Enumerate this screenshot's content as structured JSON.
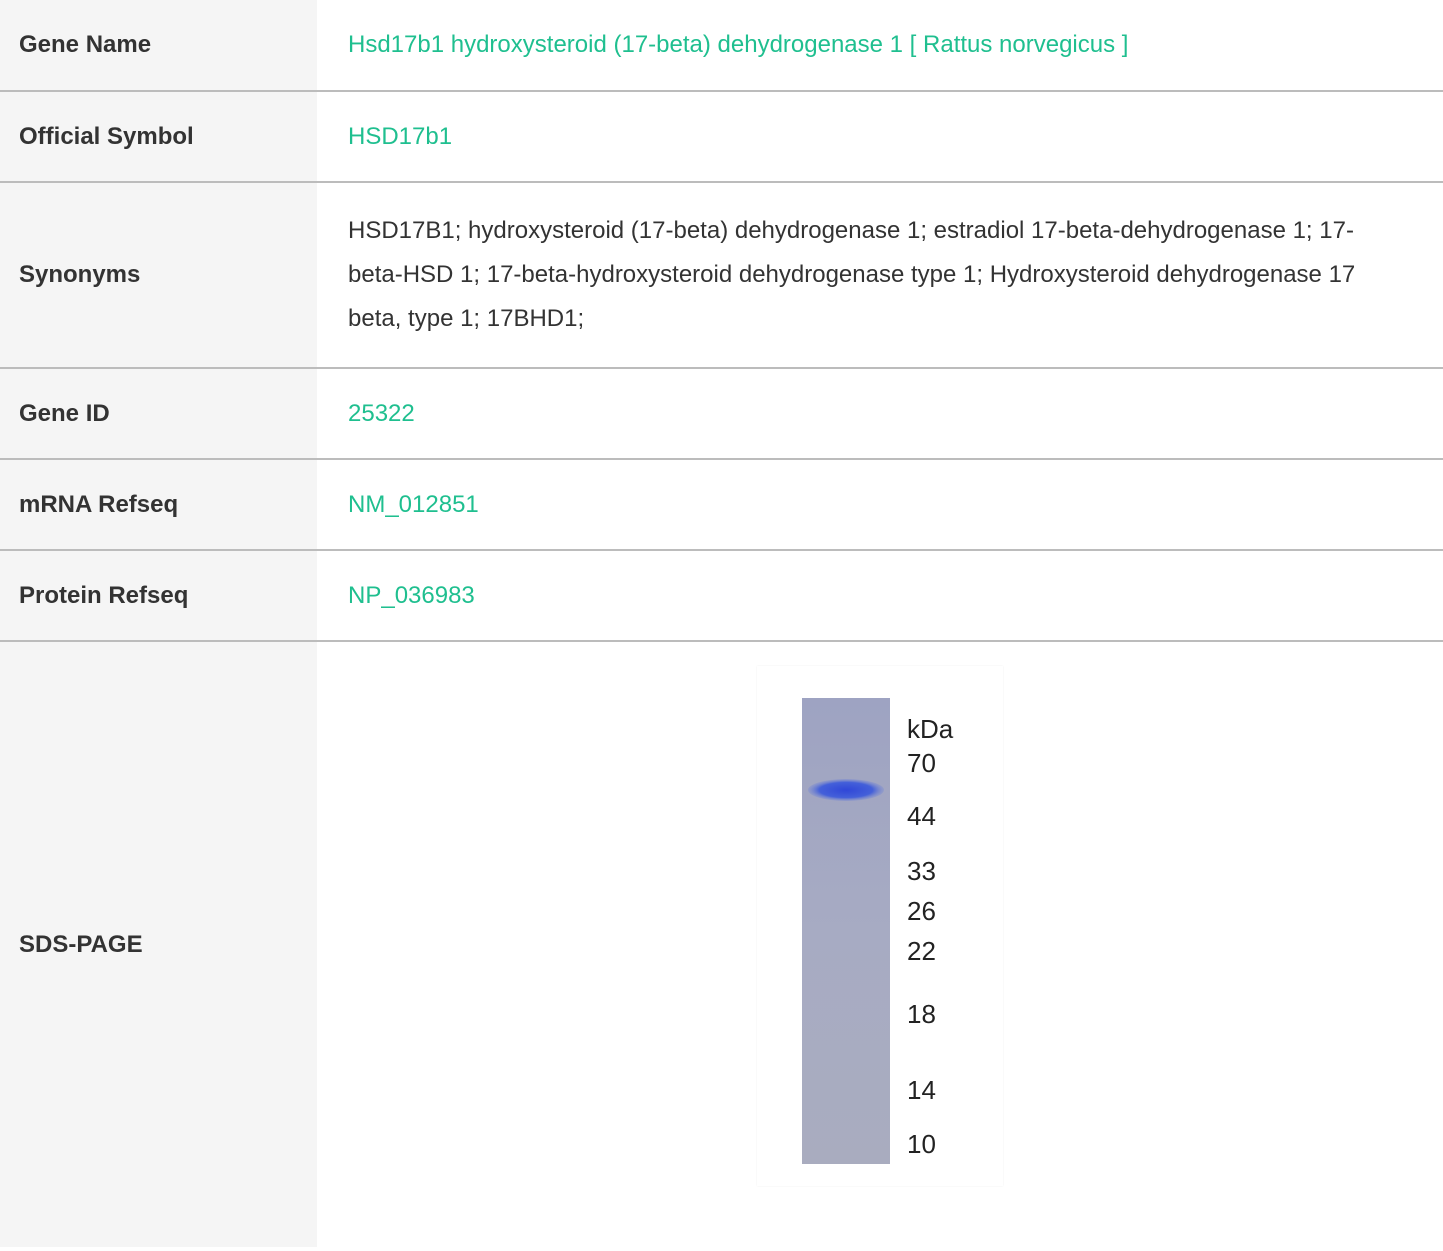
{
  "rows": [
    {
      "label": "Gene Name",
      "value": "Hsd17b1 hydroxysteroid (17-beta) dehydrogenase 1 [ Rattus norvegicus ]",
      "is_link": true
    },
    {
      "label": "Official Symbol",
      "value": "HSD17b1",
      "is_link": true
    },
    {
      "label": "Synonyms",
      "value": "HSD17B1; hydroxysteroid (17-beta) dehydrogenase 1; estradiol 17-beta-dehydrogenase 1; 17-beta-HSD 1; 17-beta-hydroxysteroid dehydrogenase type 1; Hydroxysteroid dehydrogenase 17 beta, type 1; 17BHD1;",
      "is_link": false
    },
    {
      "label": "Gene ID",
      "value": "25322",
      "is_link": true
    },
    {
      "label": "mRNA Refseq",
      "value": "NM_012851",
      "is_link": true
    },
    {
      "label": "Protein Refseq",
      "value": "NP_036983",
      "is_link": true
    },
    {
      "label": "SDS-PAGE",
      "value": "",
      "is_link": false
    }
  ],
  "gel": {
    "unit_label": "kDa",
    "markers": [
      "70",
      "44",
      "33",
      "26",
      "22",
      "18",
      "14",
      "10"
    ],
    "lane_color": "#a4a8c0",
    "band_color": "#3b55d6"
  },
  "colors": {
    "link": "#1fbf8f",
    "text": "#333333",
    "label_bg": "#f5f5f5",
    "divider": "#bcbcbc"
  }
}
